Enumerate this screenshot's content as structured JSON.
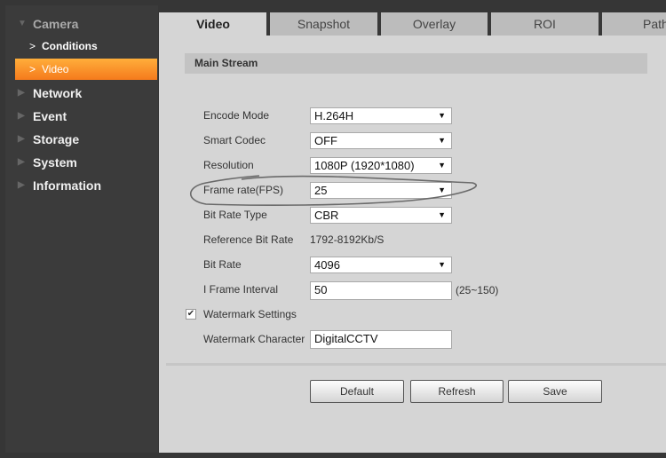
{
  "sidebar": {
    "camera": "Camera",
    "sub": [
      "Conditions",
      "Video"
    ],
    "items": [
      "Network",
      "Event",
      "Storage",
      "System",
      "Information"
    ]
  },
  "tabs": [
    "Video",
    "Snapshot",
    "Overlay",
    "ROI",
    "Path"
  ],
  "section": "Main Stream",
  "fields": {
    "encode_mode": {
      "label": "Encode Mode",
      "value": "H.264H"
    },
    "smart_codec": {
      "label": "Smart Codec",
      "value": "OFF"
    },
    "resolution": {
      "label": "Resolution",
      "value": "1080P (1920*1080)"
    },
    "frame_rate": {
      "label": "Frame rate(FPS)",
      "value": "25"
    },
    "bit_rate_type": {
      "label": "Bit Rate Type",
      "value": "CBR"
    },
    "reference_bit_rate": {
      "label": "Reference Bit Rate",
      "value": "1792-8192Kb/S"
    },
    "bit_rate": {
      "label": "Bit Rate",
      "value": "4096"
    },
    "i_frame_interval": {
      "label": "I Frame Interval",
      "value": "50",
      "hint": "(25~150)"
    },
    "watermark_settings": {
      "label": "Watermark Settings",
      "checked": true
    },
    "watermark_character": {
      "label": "Watermark Character",
      "value": "DigitalCCTV"
    }
  },
  "buttons": {
    "default": "Default",
    "refresh": "Refresh",
    "save": "Save"
  },
  "icons": {
    "dropdown": "▼",
    "check": "✔",
    "expand": "▶",
    "collapse": "▼",
    "chevron": ">"
  }
}
